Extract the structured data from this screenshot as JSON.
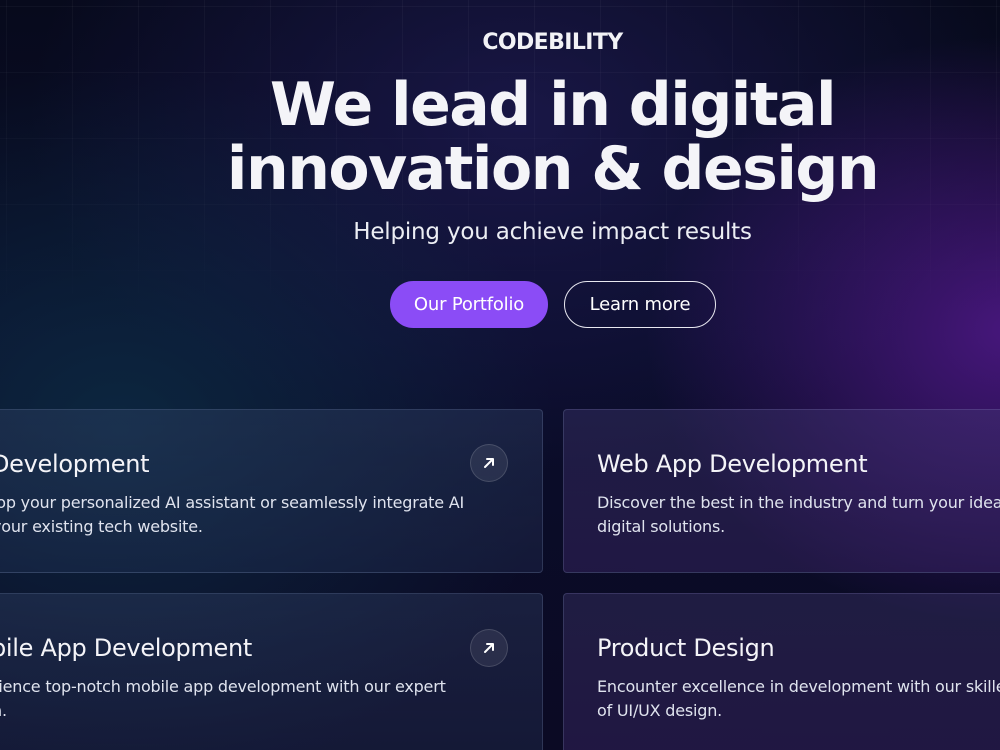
{
  "brand": {
    "name": "CODEBILITY"
  },
  "hero": {
    "title_line1": "We lead in digital",
    "title_line2": "innovation & design",
    "subtitle": "Helping you achieve impact results"
  },
  "buttons": {
    "primary_label": "Our Portfolio",
    "secondary_label": "Learn more"
  },
  "services": [
    {
      "title": "Development",
      "desc_line1": "lop your personalized AI assistant or seamlessly integrate AI",
      "desc_line2": "your existing tech website.",
      "icon": "arrow-up-right-icon"
    },
    {
      "title": "Web App Development",
      "desc_line1": "Discover the best in the industry and turn your idea",
      "desc_line2": "digital solutions.",
      "icon": ""
    },
    {
      "title": "bile App Development",
      "desc_line1": "rience top-notch mobile app development with our expert",
      "desc_line2": "n.",
      "icon": "arrow-up-right-icon"
    },
    {
      "title": "Product Design",
      "desc_line1": "Encounter excellence in development with our skille",
      "desc_line2": "of UI/UX design.",
      "icon": ""
    }
  ],
  "colors": {
    "accent": "#8b4cf6",
    "background": "#06091a",
    "text": "#ffffff"
  }
}
